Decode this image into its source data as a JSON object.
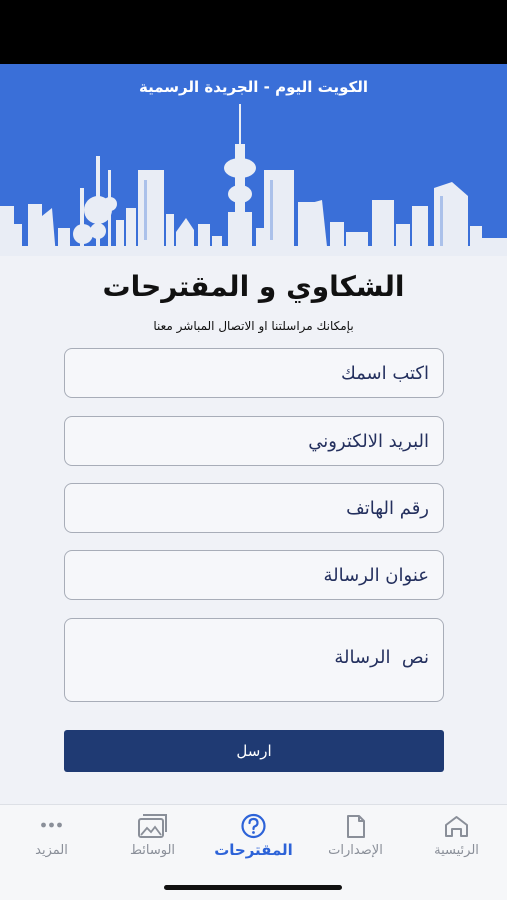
{
  "header": {
    "title": "الكويت اليوم - الجريدة الرسمية"
  },
  "page": {
    "title": "الشكاوي و المقترحات",
    "subtitle": "بإمكانك مراسلتنا او الاتصال المباشر معنا"
  },
  "form": {
    "name_placeholder": "اكتب اسمك",
    "email_placeholder": "البريد الالكتروني",
    "phone_placeholder": "رقم الهاتف",
    "subject_placeholder": "عنوان الرسالة",
    "message_placeholder": "نص  الرسالة",
    "submit_label": "ارسل"
  },
  "tabs": [
    {
      "label": "الرئيسية",
      "icon": "home-icon"
    },
    {
      "label": "الإصدارات",
      "icon": "document-icon"
    },
    {
      "label": "المقترحات",
      "icon": "question-circle-icon",
      "active": true
    },
    {
      "label": "الوسائط",
      "icon": "image-gallery-icon"
    },
    {
      "label": "المزيد",
      "icon": "more-dots-icon"
    }
  ],
  "colors": {
    "header_blue": "#3a6fd8",
    "button_navy": "#1f3a73",
    "active_tab": "#2d63d8",
    "inactive_tab": "#8a8f99"
  }
}
